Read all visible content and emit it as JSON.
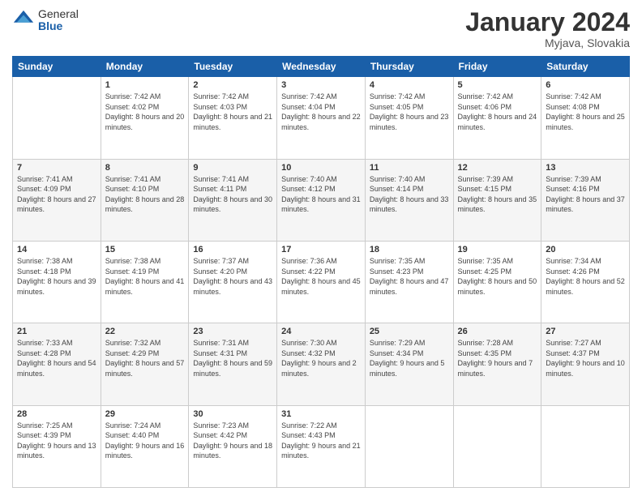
{
  "header": {
    "logo_general": "General",
    "logo_blue": "Blue",
    "month_title": "January 2024",
    "location": "Myjava, Slovakia"
  },
  "days_of_week": [
    "Sunday",
    "Monday",
    "Tuesday",
    "Wednesday",
    "Thursday",
    "Friday",
    "Saturday"
  ],
  "weeks": [
    [
      {
        "day": "",
        "sunrise": "",
        "sunset": "",
        "daylight": ""
      },
      {
        "day": "1",
        "sunrise": "Sunrise: 7:42 AM",
        "sunset": "Sunset: 4:02 PM",
        "daylight": "Daylight: 8 hours and 20 minutes."
      },
      {
        "day": "2",
        "sunrise": "Sunrise: 7:42 AM",
        "sunset": "Sunset: 4:03 PM",
        "daylight": "Daylight: 8 hours and 21 minutes."
      },
      {
        "day": "3",
        "sunrise": "Sunrise: 7:42 AM",
        "sunset": "Sunset: 4:04 PM",
        "daylight": "Daylight: 8 hours and 22 minutes."
      },
      {
        "day": "4",
        "sunrise": "Sunrise: 7:42 AM",
        "sunset": "Sunset: 4:05 PM",
        "daylight": "Daylight: 8 hours and 23 minutes."
      },
      {
        "day": "5",
        "sunrise": "Sunrise: 7:42 AM",
        "sunset": "Sunset: 4:06 PM",
        "daylight": "Daylight: 8 hours and 24 minutes."
      },
      {
        "day": "6",
        "sunrise": "Sunrise: 7:42 AM",
        "sunset": "Sunset: 4:08 PM",
        "daylight": "Daylight: 8 hours and 25 minutes."
      }
    ],
    [
      {
        "day": "7",
        "sunrise": "Sunrise: 7:41 AM",
        "sunset": "Sunset: 4:09 PM",
        "daylight": "Daylight: 8 hours and 27 minutes."
      },
      {
        "day": "8",
        "sunrise": "Sunrise: 7:41 AM",
        "sunset": "Sunset: 4:10 PM",
        "daylight": "Daylight: 8 hours and 28 minutes."
      },
      {
        "day": "9",
        "sunrise": "Sunrise: 7:41 AM",
        "sunset": "Sunset: 4:11 PM",
        "daylight": "Daylight: 8 hours and 30 minutes."
      },
      {
        "day": "10",
        "sunrise": "Sunrise: 7:40 AM",
        "sunset": "Sunset: 4:12 PM",
        "daylight": "Daylight: 8 hours and 31 minutes."
      },
      {
        "day": "11",
        "sunrise": "Sunrise: 7:40 AM",
        "sunset": "Sunset: 4:14 PM",
        "daylight": "Daylight: 8 hours and 33 minutes."
      },
      {
        "day": "12",
        "sunrise": "Sunrise: 7:39 AM",
        "sunset": "Sunset: 4:15 PM",
        "daylight": "Daylight: 8 hours and 35 minutes."
      },
      {
        "day": "13",
        "sunrise": "Sunrise: 7:39 AM",
        "sunset": "Sunset: 4:16 PM",
        "daylight": "Daylight: 8 hours and 37 minutes."
      }
    ],
    [
      {
        "day": "14",
        "sunrise": "Sunrise: 7:38 AM",
        "sunset": "Sunset: 4:18 PM",
        "daylight": "Daylight: 8 hours and 39 minutes."
      },
      {
        "day": "15",
        "sunrise": "Sunrise: 7:38 AM",
        "sunset": "Sunset: 4:19 PM",
        "daylight": "Daylight: 8 hours and 41 minutes."
      },
      {
        "day": "16",
        "sunrise": "Sunrise: 7:37 AM",
        "sunset": "Sunset: 4:20 PM",
        "daylight": "Daylight: 8 hours and 43 minutes."
      },
      {
        "day": "17",
        "sunrise": "Sunrise: 7:36 AM",
        "sunset": "Sunset: 4:22 PM",
        "daylight": "Daylight: 8 hours and 45 minutes."
      },
      {
        "day": "18",
        "sunrise": "Sunrise: 7:35 AM",
        "sunset": "Sunset: 4:23 PM",
        "daylight": "Daylight: 8 hours and 47 minutes."
      },
      {
        "day": "19",
        "sunrise": "Sunrise: 7:35 AM",
        "sunset": "Sunset: 4:25 PM",
        "daylight": "Daylight: 8 hours and 50 minutes."
      },
      {
        "day": "20",
        "sunrise": "Sunrise: 7:34 AM",
        "sunset": "Sunset: 4:26 PM",
        "daylight": "Daylight: 8 hours and 52 minutes."
      }
    ],
    [
      {
        "day": "21",
        "sunrise": "Sunrise: 7:33 AM",
        "sunset": "Sunset: 4:28 PM",
        "daylight": "Daylight: 8 hours and 54 minutes."
      },
      {
        "day": "22",
        "sunrise": "Sunrise: 7:32 AM",
        "sunset": "Sunset: 4:29 PM",
        "daylight": "Daylight: 8 hours and 57 minutes."
      },
      {
        "day": "23",
        "sunrise": "Sunrise: 7:31 AM",
        "sunset": "Sunset: 4:31 PM",
        "daylight": "Daylight: 8 hours and 59 minutes."
      },
      {
        "day": "24",
        "sunrise": "Sunrise: 7:30 AM",
        "sunset": "Sunset: 4:32 PM",
        "daylight": "Daylight: 9 hours and 2 minutes."
      },
      {
        "day": "25",
        "sunrise": "Sunrise: 7:29 AM",
        "sunset": "Sunset: 4:34 PM",
        "daylight": "Daylight: 9 hours and 5 minutes."
      },
      {
        "day": "26",
        "sunrise": "Sunrise: 7:28 AM",
        "sunset": "Sunset: 4:35 PM",
        "daylight": "Daylight: 9 hours and 7 minutes."
      },
      {
        "day": "27",
        "sunrise": "Sunrise: 7:27 AM",
        "sunset": "Sunset: 4:37 PM",
        "daylight": "Daylight: 9 hours and 10 minutes."
      }
    ],
    [
      {
        "day": "28",
        "sunrise": "Sunrise: 7:25 AM",
        "sunset": "Sunset: 4:39 PM",
        "daylight": "Daylight: 9 hours and 13 minutes."
      },
      {
        "day": "29",
        "sunrise": "Sunrise: 7:24 AM",
        "sunset": "Sunset: 4:40 PM",
        "daylight": "Daylight: 9 hours and 16 minutes."
      },
      {
        "day": "30",
        "sunrise": "Sunrise: 7:23 AM",
        "sunset": "Sunset: 4:42 PM",
        "daylight": "Daylight: 9 hours and 18 minutes."
      },
      {
        "day": "31",
        "sunrise": "Sunrise: 7:22 AM",
        "sunset": "Sunset: 4:43 PM",
        "daylight": "Daylight: 9 hours and 21 minutes."
      },
      {
        "day": "",
        "sunrise": "",
        "sunset": "",
        "daylight": ""
      },
      {
        "day": "",
        "sunrise": "",
        "sunset": "",
        "daylight": ""
      },
      {
        "day": "",
        "sunrise": "",
        "sunset": "",
        "daylight": ""
      }
    ]
  ]
}
